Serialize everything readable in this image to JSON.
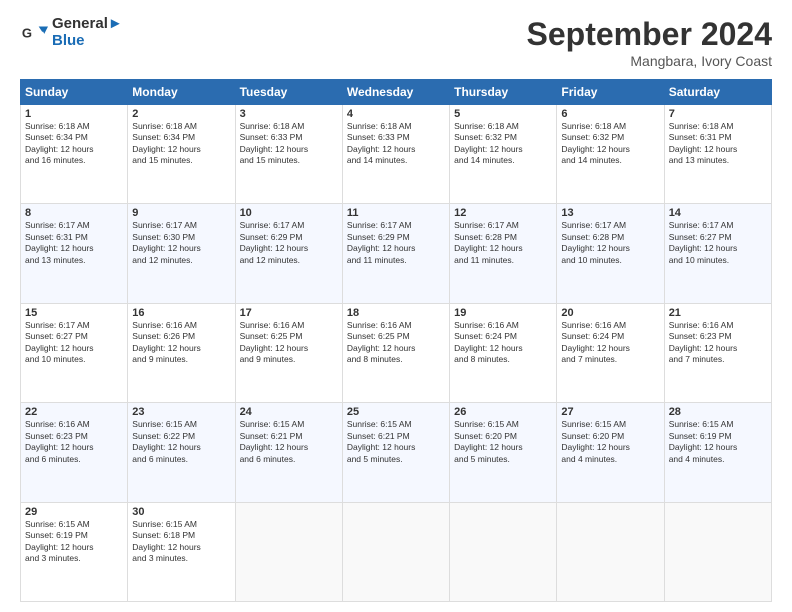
{
  "header": {
    "logo_line1": "General",
    "logo_line2": "Blue",
    "month": "September 2024",
    "location": "Mangbara, Ivory Coast"
  },
  "weekdays": [
    "Sunday",
    "Monday",
    "Tuesday",
    "Wednesday",
    "Thursday",
    "Friday",
    "Saturday"
  ],
  "weeks": [
    [
      {
        "day": "1",
        "sunrise": "6:18 AM",
        "sunset": "6:34 PM",
        "daylight": "12 hours and 16 minutes."
      },
      {
        "day": "2",
        "sunrise": "6:18 AM",
        "sunset": "6:34 PM",
        "daylight": "12 hours and 15 minutes."
      },
      {
        "day": "3",
        "sunrise": "6:18 AM",
        "sunset": "6:33 PM",
        "daylight": "12 hours and 15 minutes."
      },
      {
        "day": "4",
        "sunrise": "6:18 AM",
        "sunset": "6:33 PM",
        "daylight": "12 hours and 14 minutes."
      },
      {
        "day": "5",
        "sunrise": "6:18 AM",
        "sunset": "6:32 PM",
        "daylight": "12 hours and 14 minutes."
      },
      {
        "day": "6",
        "sunrise": "6:18 AM",
        "sunset": "6:32 PM",
        "daylight": "12 hours and 14 minutes."
      },
      {
        "day": "7",
        "sunrise": "6:18 AM",
        "sunset": "6:31 PM",
        "daylight": "12 hours and 13 minutes."
      }
    ],
    [
      {
        "day": "8",
        "sunrise": "6:17 AM",
        "sunset": "6:31 PM",
        "daylight": "12 hours and 13 minutes."
      },
      {
        "day": "9",
        "sunrise": "6:17 AM",
        "sunset": "6:30 PM",
        "daylight": "12 hours and 12 minutes."
      },
      {
        "day": "10",
        "sunrise": "6:17 AM",
        "sunset": "6:29 PM",
        "daylight": "12 hours and 12 minutes."
      },
      {
        "day": "11",
        "sunrise": "6:17 AM",
        "sunset": "6:29 PM",
        "daylight": "12 hours and 11 minutes."
      },
      {
        "day": "12",
        "sunrise": "6:17 AM",
        "sunset": "6:28 PM",
        "daylight": "12 hours and 11 minutes."
      },
      {
        "day": "13",
        "sunrise": "6:17 AM",
        "sunset": "6:28 PM",
        "daylight": "12 hours and 10 minutes."
      },
      {
        "day": "14",
        "sunrise": "6:17 AM",
        "sunset": "6:27 PM",
        "daylight": "12 hours and 10 minutes."
      }
    ],
    [
      {
        "day": "15",
        "sunrise": "6:17 AM",
        "sunset": "6:27 PM",
        "daylight": "12 hours and 10 minutes."
      },
      {
        "day": "16",
        "sunrise": "6:16 AM",
        "sunset": "6:26 PM",
        "daylight": "12 hours and 9 minutes."
      },
      {
        "day": "17",
        "sunrise": "6:16 AM",
        "sunset": "6:25 PM",
        "daylight": "12 hours and 9 minutes."
      },
      {
        "day": "18",
        "sunrise": "6:16 AM",
        "sunset": "6:25 PM",
        "daylight": "12 hours and 8 minutes."
      },
      {
        "day": "19",
        "sunrise": "6:16 AM",
        "sunset": "6:24 PM",
        "daylight": "12 hours and 8 minutes."
      },
      {
        "day": "20",
        "sunrise": "6:16 AM",
        "sunset": "6:24 PM",
        "daylight": "12 hours and 7 minutes."
      },
      {
        "day": "21",
        "sunrise": "6:16 AM",
        "sunset": "6:23 PM",
        "daylight": "12 hours and 7 minutes."
      }
    ],
    [
      {
        "day": "22",
        "sunrise": "6:16 AM",
        "sunset": "6:23 PM",
        "daylight": "12 hours and 6 minutes."
      },
      {
        "day": "23",
        "sunrise": "6:15 AM",
        "sunset": "6:22 PM",
        "daylight": "12 hours and 6 minutes."
      },
      {
        "day": "24",
        "sunrise": "6:15 AM",
        "sunset": "6:21 PM",
        "daylight": "12 hours and 6 minutes."
      },
      {
        "day": "25",
        "sunrise": "6:15 AM",
        "sunset": "6:21 PM",
        "daylight": "12 hours and 5 minutes."
      },
      {
        "day": "26",
        "sunrise": "6:15 AM",
        "sunset": "6:20 PM",
        "daylight": "12 hours and 5 minutes."
      },
      {
        "day": "27",
        "sunrise": "6:15 AM",
        "sunset": "6:20 PM",
        "daylight": "12 hours and 4 minutes."
      },
      {
        "day": "28",
        "sunrise": "6:15 AM",
        "sunset": "6:19 PM",
        "daylight": "12 hours and 4 minutes."
      }
    ],
    [
      {
        "day": "29",
        "sunrise": "6:15 AM",
        "sunset": "6:19 PM",
        "daylight": "12 hours and 3 minutes."
      },
      {
        "day": "30",
        "sunrise": "6:15 AM",
        "sunset": "6:18 PM",
        "daylight": "12 hours and 3 minutes."
      },
      null,
      null,
      null,
      null,
      null
    ]
  ]
}
